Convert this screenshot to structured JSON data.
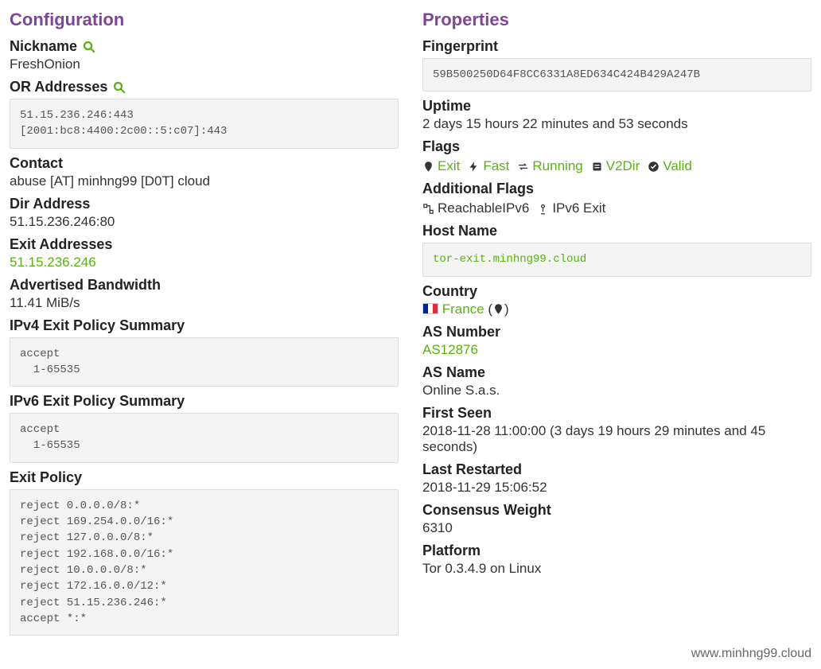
{
  "left": {
    "section": "Configuration",
    "nickname_label": "Nickname",
    "nickname": "FreshOnion",
    "or_label": "OR Addresses",
    "or_addresses": "51.15.236.246:443\n[2001:bc8:4400:2c00::5:c07]:443",
    "contact_label": "Contact",
    "contact": "abuse [AT] minhng99 [D0T] cloud",
    "dir_label": "Dir Address",
    "dir": "51.15.236.246:80",
    "exit_addr_label": "Exit Addresses",
    "exit_addr": "51.15.236.246",
    "bw_label": "Advertised Bandwidth",
    "bw": "11.41 MiB/s",
    "ipv4_summary_label": "IPv4 Exit Policy Summary",
    "ipv4_summary": "accept\n  1-65535",
    "ipv6_summary_label": "IPv6 Exit Policy Summary",
    "ipv6_summary": "accept\n  1-65535",
    "exit_policy_label": "Exit Policy",
    "exit_policy": "reject 0.0.0.0/8:*\nreject 169.254.0.0/16:*\nreject 127.0.0.0/8:*\nreject 192.168.0.0/16:*\nreject 10.0.0.0/8:*\nreject 172.16.0.0/12:*\nreject 51.15.236.246:*\naccept *:*"
  },
  "right": {
    "section": "Properties",
    "fp_label": "Fingerprint",
    "fp": "59B500250D64F8CC6331A8ED634C424B429A247B",
    "uptime_label": "Uptime",
    "uptime": "2 days 15 hours 22 minutes and 53 seconds",
    "flags_label": "Flags",
    "flags": {
      "exit": "Exit",
      "fast": "Fast",
      "running": "Running",
      "v2dir": "V2Dir",
      "valid": "Valid"
    },
    "addflags_label": "Additional Flags",
    "addflags": {
      "reach6": "ReachableIPv6",
      "ipv6exit": "IPv6 Exit"
    },
    "host_label": "Host Name",
    "host": "tor-exit.minhng99.cloud",
    "country_label": "Country",
    "country": "France",
    "asnum_label": "AS Number",
    "asnum": "AS12876",
    "asname_label": "AS Name",
    "asname": "Online S.a.s.",
    "firstseen_label": "First Seen",
    "firstseen": "2018-11-28 11:00:00 (3 days 19 hours 29 minutes and 45 seconds)",
    "lastrestart_label": "Last Restarted",
    "lastrestart": "2018-11-29 15:06:52",
    "weight_label": "Consensus Weight",
    "weight": "6310",
    "platform_label": "Platform",
    "platform": "Tor 0.3.4.9 on Linux"
  },
  "footer": "www.minhng99.cloud"
}
